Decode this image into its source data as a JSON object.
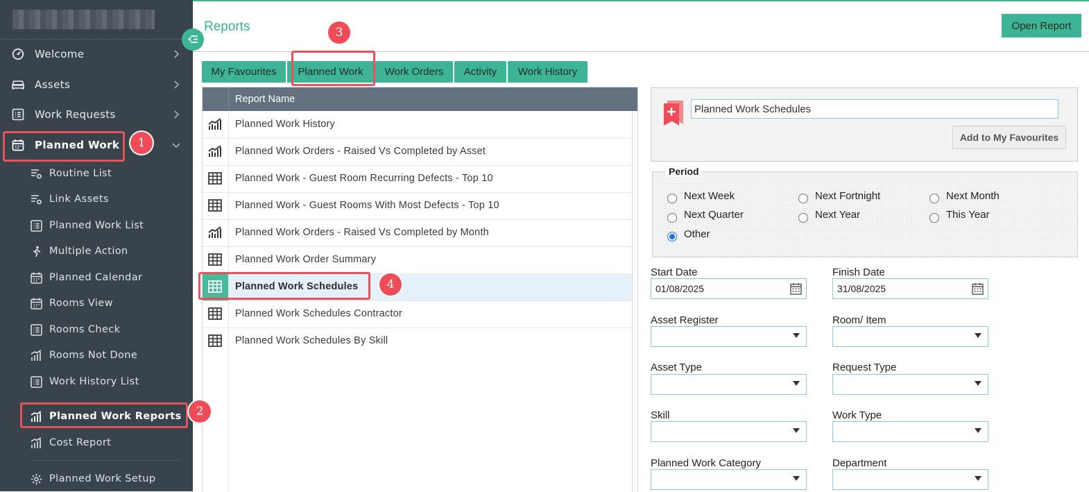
{
  "colors": {
    "accent": "#3db493",
    "sidebar_bg": "#39434c",
    "highlight": "#e8505b",
    "list_header": "#637181"
  },
  "sidebar": {
    "nav": [
      {
        "label": "Welcome",
        "icon": "dashboard-icon",
        "chevron": "chevron-right-icon"
      },
      {
        "label": "Assets",
        "icon": "bed-icon",
        "chevron": "chevron-right-icon"
      },
      {
        "label": "Work Requests",
        "icon": "list-icon",
        "chevron": "chevron-right-icon"
      },
      {
        "label": "Planned Work",
        "icon": "calendar-icon",
        "chevron": "chevron-down-icon"
      }
    ],
    "sub": [
      {
        "label": "Routine List",
        "icon": "filter-gear-icon"
      },
      {
        "label": "Link Assets",
        "icon": "filter-gear-icon"
      },
      {
        "label": "Planned Work List",
        "icon": "list-icon"
      },
      {
        "label": "Multiple Action",
        "icon": "running-person-icon"
      },
      {
        "label": "Planned Calendar",
        "icon": "calendar-icon"
      },
      {
        "label": "Rooms View",
        "icon": "calendar-icon"
      },
      {
        "label": "Rooms Check",
        "icon": "list-icon"
      },
      {
        "label": "Rooms Not Done",
        "icon": "bar-chart-icon"
      },
      {
        "label": "Work History List",
        "icon": "list-icon"
      },
      {
        "label": "Planned Work Reports",
        "icon": "bar-chart-icon"
      },
      {
        "label": "Cost Report",
        "icon": "bar-chart-icon"
      },
      {
        "label": "Planned Work Setup",
        "icon": "gear-icon"
      }
    ]
  },
  "header": {
    "title": "Reports",
    "open_report": "Open Report"
  },
  "tabs": [
    {
      "label": "My Favourites"
    },
    {
      "label": "Planned Work",
      "active": true
    },
    {
      "label": "Work Orders"
    },
    {
      "label": "Activity"
    },
    {
      "label": "Work History"
    }
  ],
  "report_list": {
    "column_header": "Report Name",
    "rows": [
      {
        "name": "Planned Work History",
        "icon": "chart-icon"
      },
      {
        "name": "Planned Work Orders - Raised Vs Completed by Asset",
        "icon": "chart-icon"
      },
      {
        "name": "Planned Work - Guest Room Recurring Defects - Top 10",
        "icon": "table-icon"
      },
      {
        "name": "Planned Work - Guest Rooms With Most Defects - Top 10",
        "icon": "table-icon"
      },
      {
        "name": "Planned Work Orders - Raised Vs Completed by Month",
        "icon": "chart-icon"
      },
      {
        "name": "Planned Work Order Summary",
        "icon": "table-icon"
      },
      {
        "name": "Planned Work Schedules",
        "icon": "table-icon",
        "selected": true
      },
      {
        "name": "Planned Work Schedules Contractor",
        "icon": "table-icon"
      },
      {
        "name": "Planned Work Schedules By Skill",
        "icon": "table-icon"
      }
    ]
  },
  "favourite": {
    "name_value": "Planned Work Schedules",
    "add_button": "Add to My Favourites",
    "icon": "bookmark-plus-icon"
  },
  "period": {
    "legend": "Period",
    "options": [
      "Next Week",
      "Next Fortnight",
      "Next Month",
      "Next Quarter",
      "Next Year",
      "This Year",
      "Other"
    ],
    "selected": "Other"
  },
  "filters": {
    "start_date_label": "Start Date",
    "start_date": "01/08/2025",
    "finish_date_label": "Finish Date",
    "finish_date": "31/08/2025",
    "selects": [
      {
        "label": "Asset Register",
        "value": ""
      },
      {
        "label": "Room/ Item",
        "value": ""
      },
      {
        "label": "Asset Type",
        "value": ""
      },
      {
        "label": "Request Type",
        "value": ""
      },
      {
        "label": "Skill",
        "value": ""
      },
      {
        "label": "Work Type",
        "value": ""
      },
      {
        "label": "Planned Work Category",
        "value": ""
      },
      {
        "label": "Department",
        "value": ""
      }
    ]
  },
  "annotations": [
    "1",
    "2",
    "3",
    "4"
  ]
}
